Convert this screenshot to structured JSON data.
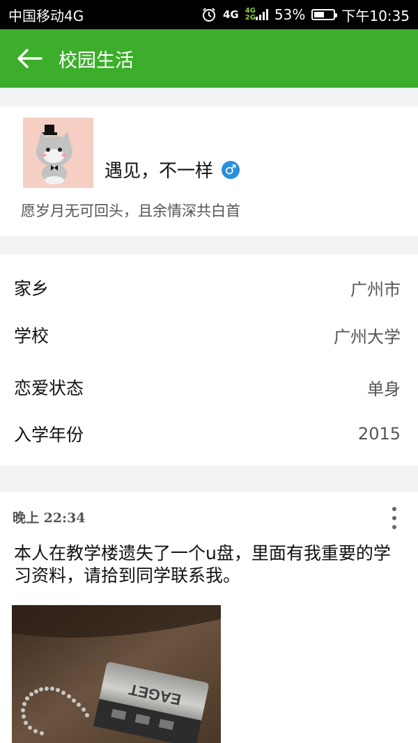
{
  "status_bar": {
    "carrier": "中国移动4G",
    "net1": "4G",
    "net2_top": "4G",
    "net2_bottom": "2G",
    "battery_percent": "53%",
    "battery_level": 0.53,
    "time": "下午10:35"
  },
  "app_bar": {
    "back_icon": "arrow-left-icon",
    "title": "校园生活"
  },
  "profile": {
    "name": "遇见，不一样",
    "gender_icon": "male-icon",
    "gender_symbol": "♂",
    "signature": "愿岁月无可回头，且余情深共白首"
  },
  "info": [
    {
      "label": "家乡",
      "value": "广州市"
    },
    {
      "label": "学校",
      "value": "广州大学"
    },
    {
      "label": "恋爱状态",
      "value": "单身"
    },
    {
      "label": "入学年份",
      "value": "2015"
    }
  ],
  "post": {
    "time": "晚上 22:34",
    "text": "本人在教学楼遗失了一个u盘，里面有我重要的学习资料，请拾到同学联系我。",
    "image_text": "EAGET"
  },
  "colors": {
    "accent": "#3dae2b",
    "gender_blue": "#2a8fdc"
  }
}
